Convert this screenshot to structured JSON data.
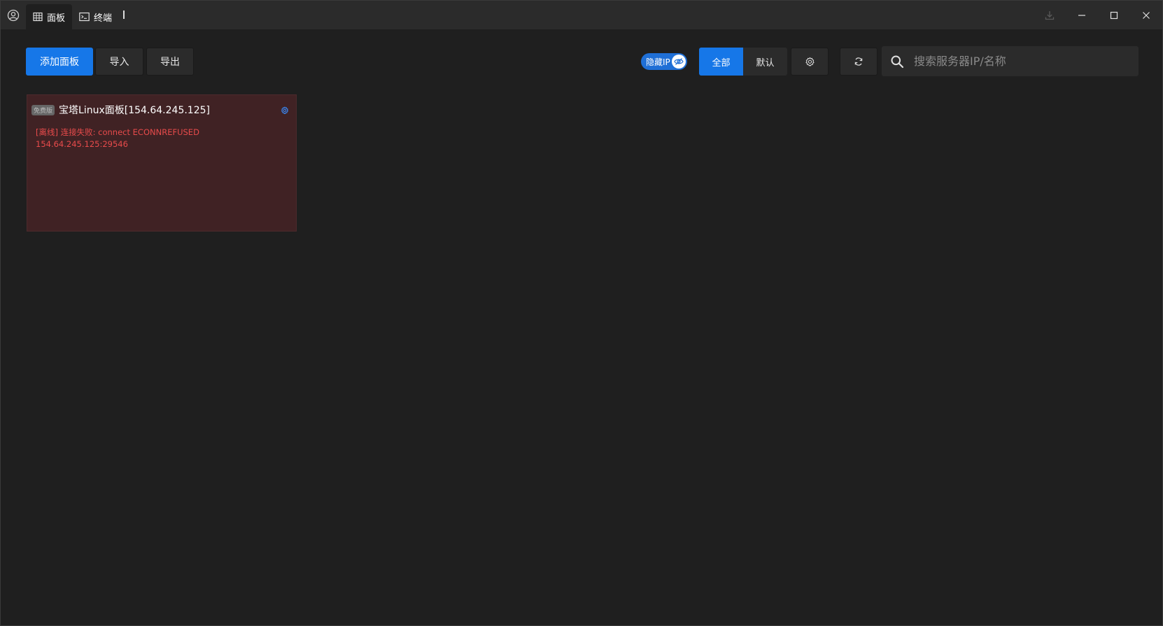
{
  "titlebar": {
    "tabs": [
      {
        "label": "面板",
        "icon": "panel-grid-icon",
        "active": true
      },
      {
        "label": "终端",
        "icon": "terminal-icon",
        "active": false
      }
    ]
  },
  "toolbar": {
    "add_panel_label": "添加面板",
    "import_label": "导入",
    "export_label": "导出",
    "hide_ip": {
      "label": "隐藏IP",
      "on": true,
      "icon": "eye-icon"
    },
    "filter": [
      {
        "label": "全部",
        "selected": true
      },
      {
        "label": "默认",
        "selected": false
      }
    ],
    "settings_icon": "gear-icon",
    "refresh_icon": "refresh-icon",
    "search": {
      "placeholder": "搜索服务器IP/名称",
      "value": "",
      "icon": "search-icon"
    }
  },
  "panels": [
    {
      "badge": "免费版",
      "title": "宝塔Linux面板[154.64.245.125]",
      "error_line1": "[离线] 连接失败: connect ECONNREFUSED",
      "error_line2": "154.64.245.125:29546",
      "status": "offline"
    }
  ],
  "colors": {
    "accent": "#1677e8",
    "background": "#1f1f1f",
    "titlebar": "#2b2b2b",
    "card_offline": "#402224",
    "error_text": "#e84b4b"
  }
}
